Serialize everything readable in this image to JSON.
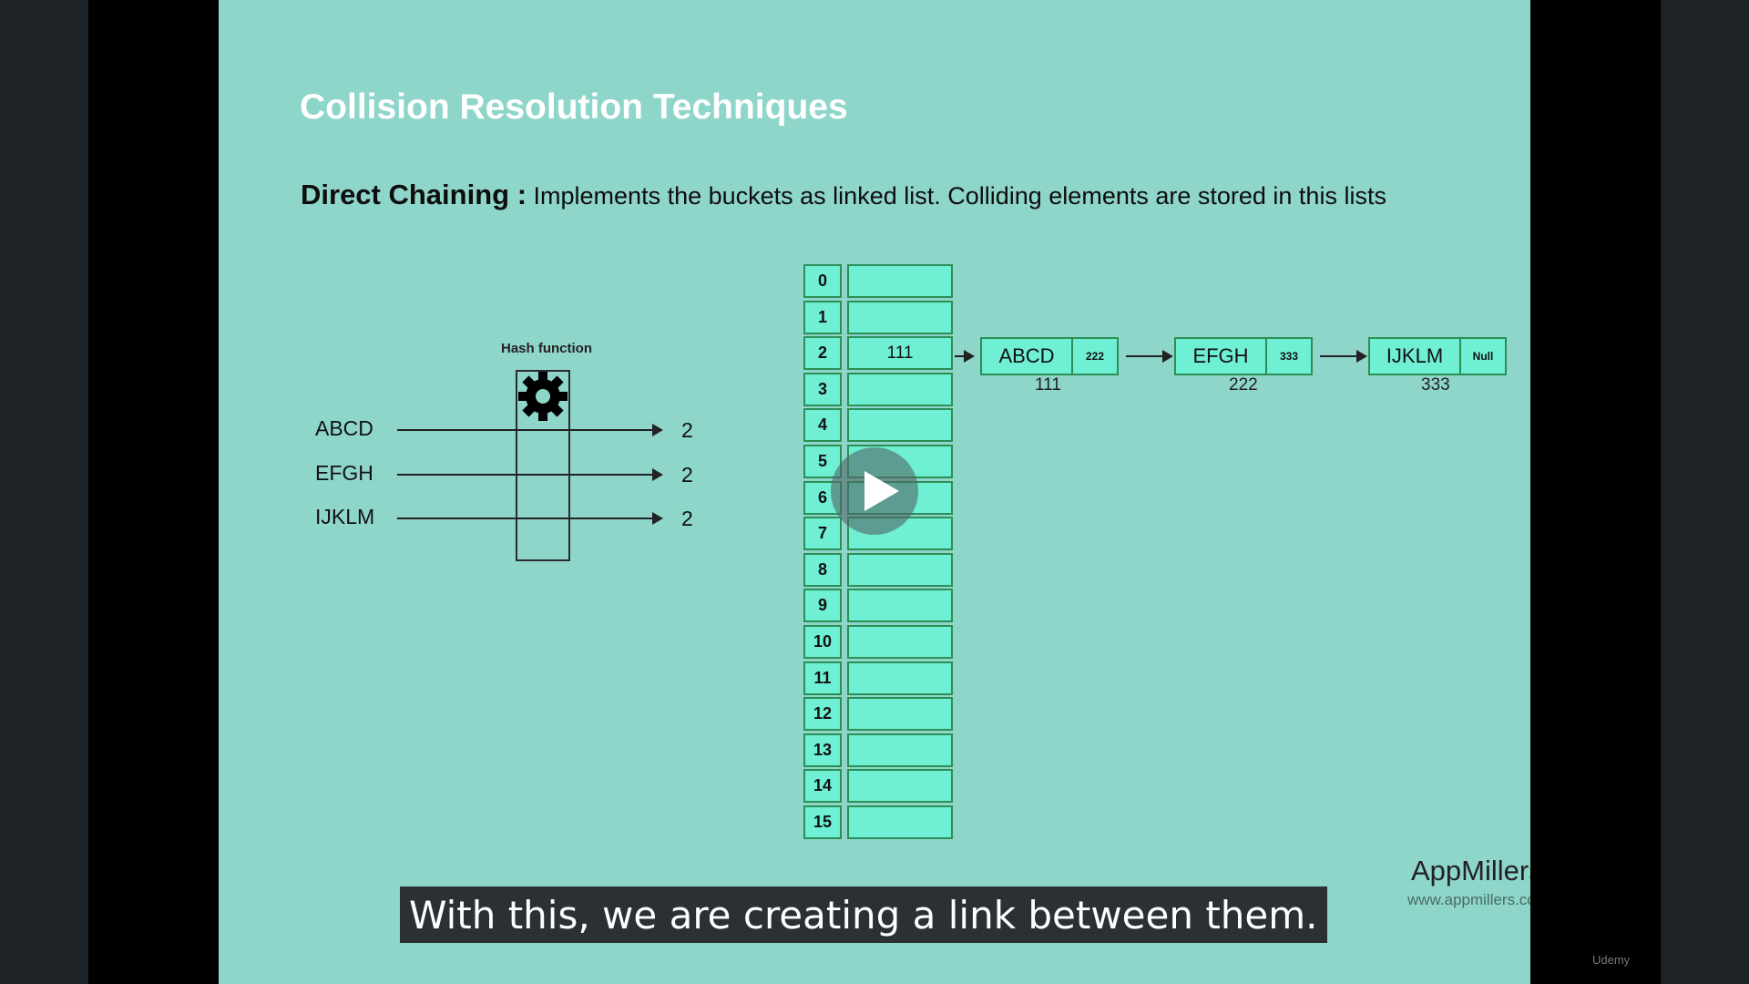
{
  "slide": {
    "title": "Collision Resolution Techniques",
    "subtitle_bold": "Direct Chaining :",
    "subtitle_text": "Implements the buckets as linked list. Colliding elements are stored in this lists"
  },
  "hash_function": {
    "label": "Hash function",
    "icon": "gear-icon",
    "inputs": [
      {
        "key": "ABCD",
        "index": "2"
      },
      {
        "key": "EFGH",
        "index": "2"
      },
      {
        "key": "IJKLM",
        "index": "2"
      }
    ]
  },
  "hash_table": {
    "rows": [
      {
        "index": "0",
        "value": ""
      },
      {
        "index": "1",
        "value": ""
      },
      {
        "index": "2",
        "value": "111"
      },
      {
        "index": "3",
        "value": ""
      },
      {
        "index": "4",
        "value": ""
      },
      {
        "index": "5",
        "value": ""
      },
      {
        "index": "6",
        "value": ""
      },
      {
        "index": "7",
        "value": ""
      },
      {
        "index": "8",
        "value": ""
      },
      {
        "index": "9",
        "value": ""
      },
      {
        "index": "10",
        "value": ""
      },
      {
        "index": "11",
        "value": ""
      },
      {
        "index": "12",
        "value": ""
      },
      {
        "index": "13",
        "value": ""
      },
      {
        "index": "14",
        "value": ""
      },
      {
        "index": "15",
        "value": ""
      }
    ]
  },
  "linked_list": [
    {
      "key": "ABCD",
      "next": "222",
      "address": "111"
    },
    {
      "key": "EFGH",
      "next": "333",
      "address": "222"
    },
    {
      "key": "IJKLM",
      "next": "Null",
      "address": "333"
    }
  ],
  "brand": {
    "name": "AppMillers",
    "url": "www.appmillers.com"
  },
  "player": {
    "play_icon": "play-icon",
    "caption": "With this, we are creating a link between them.",
    "watermark": "Udemy"
  },
  "colors": {
    "slide_bg": "#8ed5ca",
    "cell_fill": "#6fefd4",
    "cell_border": "#2c8f57"
  }
}
